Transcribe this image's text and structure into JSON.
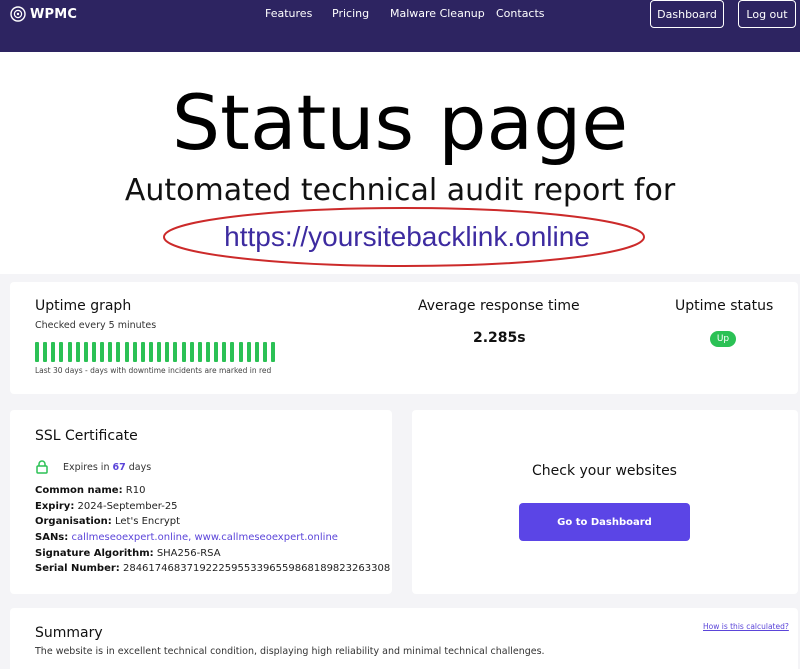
{
  "header": {
    "logo_text": "WPMC",
    "nav": [
      "Features",
      "Pricing",
      "Malware Cleanup",
      "Contacts"
    ],
    "dashboard_label": "Dashboard",
    "logout_label": "Log out",
    "bg_color": "#2d2461"
  },
  "hero": {
    "title": "Status page",
    "subtitle": "Automated technical audit report for",
    "url": "https://yoursitebacklink.online",
    "highlight_color": "#cc2a2a"
  },
  "uptime": {
    "title": "Uptime graph",
    "interval": "Checked every 5 minutes",
    "days": 30,
    "note": "Last 30 days - days with downtime incidents are marked in red",
    "bar_color": "#2bc155"
  },
  "response": {
    "title": "Average response time",
    "value": "2.285s"
  },
  "status": {
    "title": "Uptime status",
    "badge": "Up"
  },
  "ssl": {
    "title": "SSL Certificate",
    "expires_prefix": "Expires in",
    "expires_days": "67",
    "expires_suffix": "days",
    "common_name_label": "Common name:",
    "common_name": "R10",
    "expiry_label": "Expiry:",
    "expiry": "2024-September-25",
    "organisation_label": "Organisation:",
    "organisation": "Let's Encrypt",
    "sans_label": "SANs:",
    "sans": "callmeseoexpert.online, www.callmeseoexpert.online",
    "algorithm_label": "Signature Algorithm:",
    "algorithm": "SHA256-RSA",
    "serial_label": "Serial Number:",
    "serial": "284617468371922259553396559868189823263308"
  },
  "check": {
    "title": "Check your websites",
    "button": "Go to Dashboard"
  },
  "summary": {
    "title": "Summary",
    "link": "How is this calculated?",
    "text": "The website is in excellent technical condition, displaying high reliability and minimal technical challenges."
  }
}
